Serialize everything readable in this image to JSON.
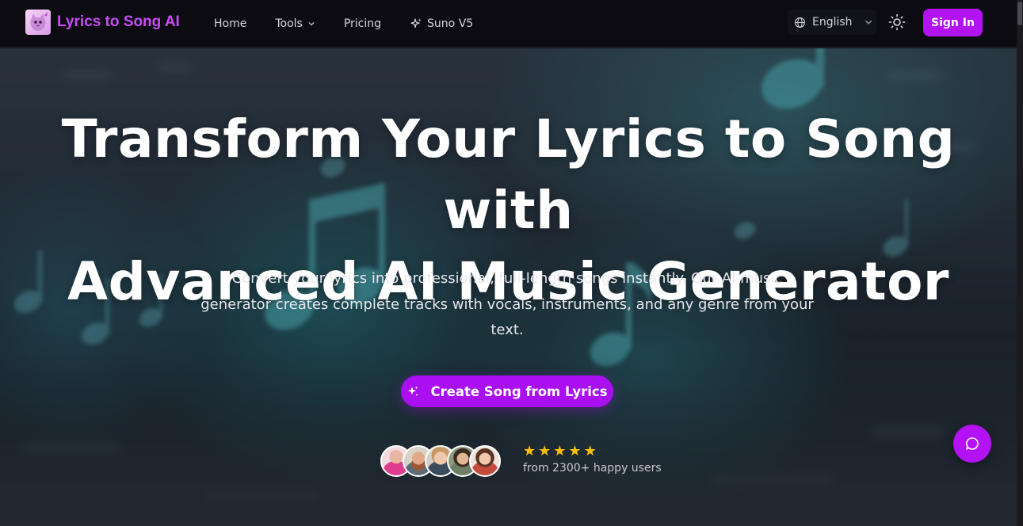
{
  "brand": {
    "name": "Lyrics to Song AI",
    "logo_icon": "cat-logo-icon"
  },
  "nav": {
    "links": [
      {
        "label": "Home"
      },
      {
        "label": "Tools"
      },
      {
        "label": "Pricing"
      },
      {
        "label": "Suno V5"
      }
    ],
    "language": "English",
    "sign_in": "Sign In"
  },
  "hero": {
    "headline_line1": "Transform Your Lyrics to Song with",
    "headline_line2": "Advanced AI Music Generator",
    "subtitle": "Convert your lyrics into professional, full-length songs instantly. Our AI music generator creates complete tracks with vocals, instruments, and any genre from your text.",
    "cta_label": "Create Song from Lyrics",
    "rating_stars": 5,
    "social_proof": "from 2300+ happy users"
  },
  "colors": {
    "accent": "#b312f5",
    "brand_text": "#c84cf5",
    "star": "#ffc107",
    "nav_bg": "#0c0b12"
  },
  "icons": [
    "cat-logo-icon",
    "chevron-down-icon",
    "sparkles-icon",
    "globe-icon",
    "sun-icon",
    "chat-bubble-icon",
    "star-icon"
  ]
}
